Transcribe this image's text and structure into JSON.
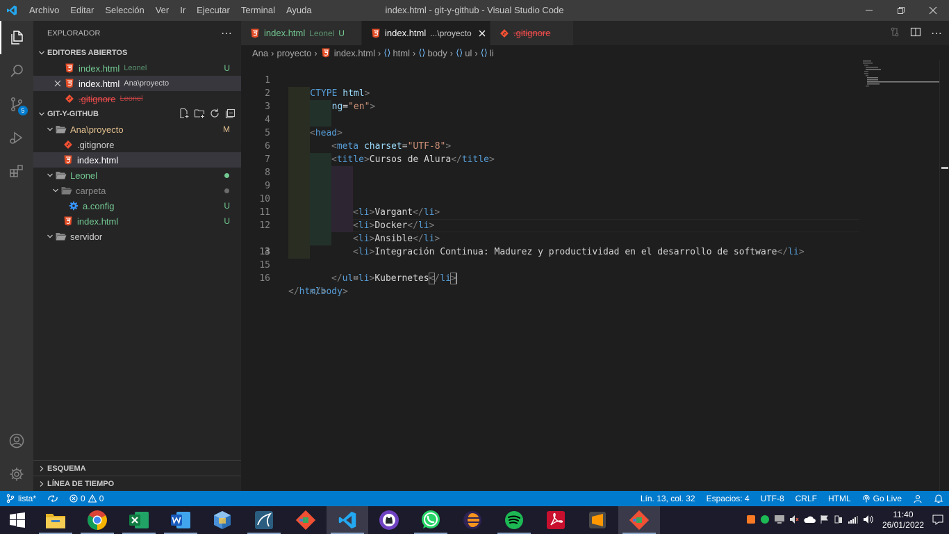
{
  "window": {
    "title": "index.html - git-y-github - Visual Studio Code",
    "menus": [
      "Archivo",
      "Editar",
      "Selección",
      "Ver",
      "Ir",
      "Ejecutar",
      "Terminal",
      "Ayuda"
    ]
  },
  "activity_bar": {
    "source_control_badge": "5"
  },
  "sidebar": {
    "title": "EXPLORADOR",
    "open_editors": {
      "label": "EDITORES ABIERTOS",
      "items": [
        {
          "name": "index.html",
          "desc": "Leonel",
          "status": "U"
        },
        {
          "name": "index.html",
          "desc": "Ana\\proyecto",
          "status": ""
        },
        {
          "name": ".gitignore",
          "desc": "Leonel",
          "status": ""
        }
      ]
    },
    "workspace": {
      "label": "GIT-Y-GITHUB",
      "tree": [
        {
          "name": "Ana\\proyecto",
          "status": "M"
        },
        {
          "name": ".gitignore"
        },
        {
          "name": "index.html"
        },
        {
          "name": "Leonel"
        },
        {
          "name": "carpeta"
        },
        {
          "name": "a.config",
          "status": "U"
        },
        {
          "name": "index.html",
          "status": "U"
        },
        {
          "name": "servidor"
        }
      ]
    },
    "outline_label": "ESQUEMA",
    "timeline_label": "LÍNEA DE TIEMPO"
  },
  "tabs": [
    {
      "name": "index.html",
      "desc": "Leonel",
      "status": "U"
    },
    {
      "name": "index.html",
      "desc": "...\\proyecto"
    },
    {
      "name": ".gitignore"
    }
  ],
  "breadcrumb": [
    "Ana",
    "proyecto",
    "index.html",
    "html",
    "body",
    "ul",
    "li"
  ],
  "code": {
    "lines": [
      "1",
      "2",
      "3",
      "4",
      "5",
      "6",
      "7",
      "8",
      "9",
      "10",
      "11",
      "12",
      "13",
      "14",
      "15",
      "16"
    ],
    "doctype_kw": "DOCTYPE",
    "html_kw": "html",
    "lang_attr": "lang",
    "lang_val": "\"en\"",
    "head": "head",
    "meta": "meta",
    "charset_attr": "charset",
    "charset_val": "\"UTF-8\"",
    "title_tag": "title",
    "title_text": "Cursos de Alura",
    "body": "body",
    "ul": "ul",
    "li": "li",
    "items": [
      "Vargant",
      "Docker",
      "Ansible",
      "Integración Continua: Madurez y productividad en el desarrollo de software",
      "Kubernetes"
    ]
  },
  "statusbar": {
    "branch": "lista*",
    "errors": "0",
    "warnings": "0",
    "position": "Lín. 13, col. 32",
    "spaces": "Espacios: 4",
    "encoding": "UTF-8",
    "eol": "CRLF",
    "language": "HTML",
    "golive": "Go Live"
  },
  "taskbar": {
    "time": "11:40",
    "date": "26/01/2022"
  },
  "colors": {
    "accent": "#007acc",
    "html_icon": "#e44d26",
    "git_icon": "#f05033",
    "untracked": "#73c991",
    "modified": "#e2c08d"
  }
}
